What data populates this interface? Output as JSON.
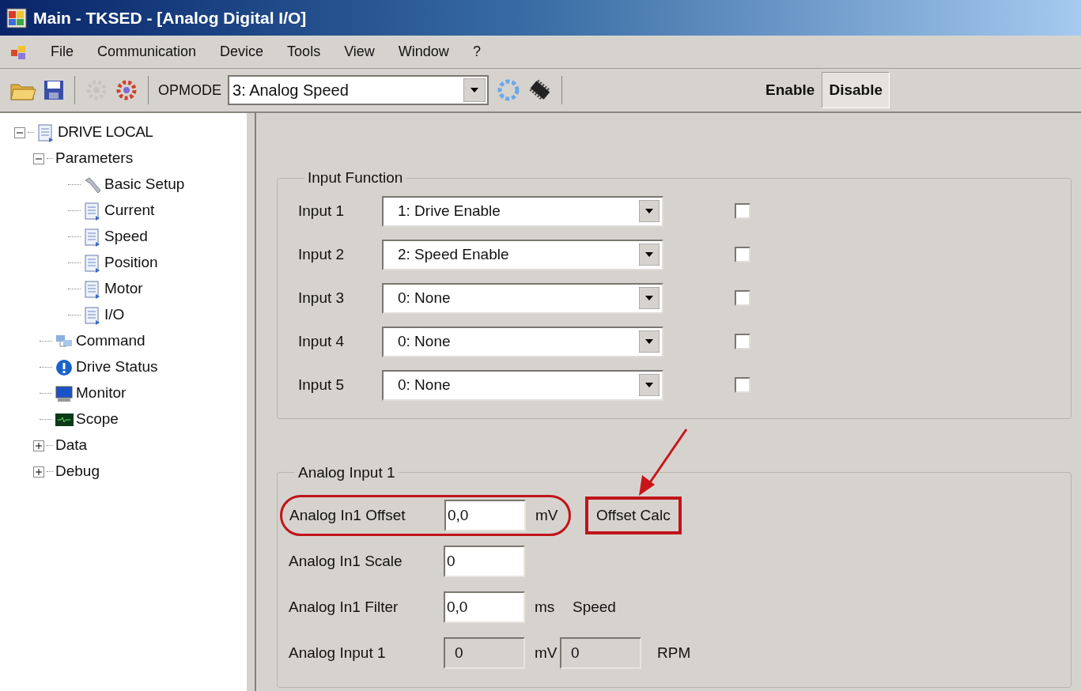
{
  "window": {
    "title": "Main - TKSED - [Analog Digital I/O]"
  },
  "menu": [
    "File",
    "Communication",
    "Device",
    "Tools",
    "View",
    "Window",
    "?"
  ],
  "toolbar": {
    "opmode_label": "OPMODE",
    "opmode": "3: Analog Speed",
    "buttons": [
      {
        "label": "Enable",
        "selected": false
      },
      {
        "label": "Disable",
        "selected": true
      }
    ]
  },
  "tree": [
    {
      "label": "DRIVE LOCAL",
      "kind": "page",
      "expanded": true,
      "children": [
        {
          "label": "Parameters",
          "kind": "folder",
          "expanded": true,
          "children": [
            {
              "label": "Basic Setup",
              "kind": "tool"
            },
            {
              "label": "Current",
              "kind": "page"
            },
            {
              "label": "Speed",
              "kind": "page"
            },
            {
              "label": "Position",
              "kind": "page"
            },
            {
              "label": "Motor",
              "kind": "page"
            },
            {
              "label": "I/O",
              "kind": "page"
            }
          ]
        },
        {
          "label": "Command",
          "kind": "network"
        },
        {
          "label": "Drive Status",
          "kind": "info"
        },
        {
          "label": "Monitor",
          "kind": "monitor"
        },
        {
          "label": "Scope",
          "kind": "scope"
        },
        {
          "label": "Data",
          "kind": "folder",
          "expanded": false
        },
        {
          "label": "Debug",
          "kind": "folder",
          "expanded": false
        }
      ]
    }
  ],
  "input_function": {
    "title": "Input Function",
    "inputs": [
      {
        "label": "Input 1",
        "value": "1: Drive Enable",
        "checked": false
      },
      {
        "label": "Input 2",
        "value": "2: Speed Enable",
        "checked": false
      },
      {
        "label": "Input 3",
        "value": "0: None",
        "checked": false
      },
      {
        "label": "Input 4",
        "value": "0: None",
        "checked": false
      },
      {
        "label": "Input 5",
        "value": "0: None",
        "checked": false
      }
    ]
  },
  "analog_input": {
    "title": "Analog Input 1",
    "rows": [
      {
        "kind": "input",
        "label": "Analog In1 Offset",
        "value": "0,0",
        "unit": "mV",
        "circled": true,
        "button": {
          "label": "Offset Calc",
          "boxed": true
        }
      },
      {
        "kind": "input",
        "label": "Analog In1 Scale",
        "value": "0"
      },
      {
        "kind": "input",
        "label": "Analog In1 Filter",
        "value": "0,0",
        "unit": "ms",
        "note": "Speed"
      },
      {
        "kind": "readout",
        "label": "Analog Input 1",
        "value": "0",
        "unit": "mV",
        "value2": "0",
        "unit2": "RPM"
      }
    ]
  }
}
